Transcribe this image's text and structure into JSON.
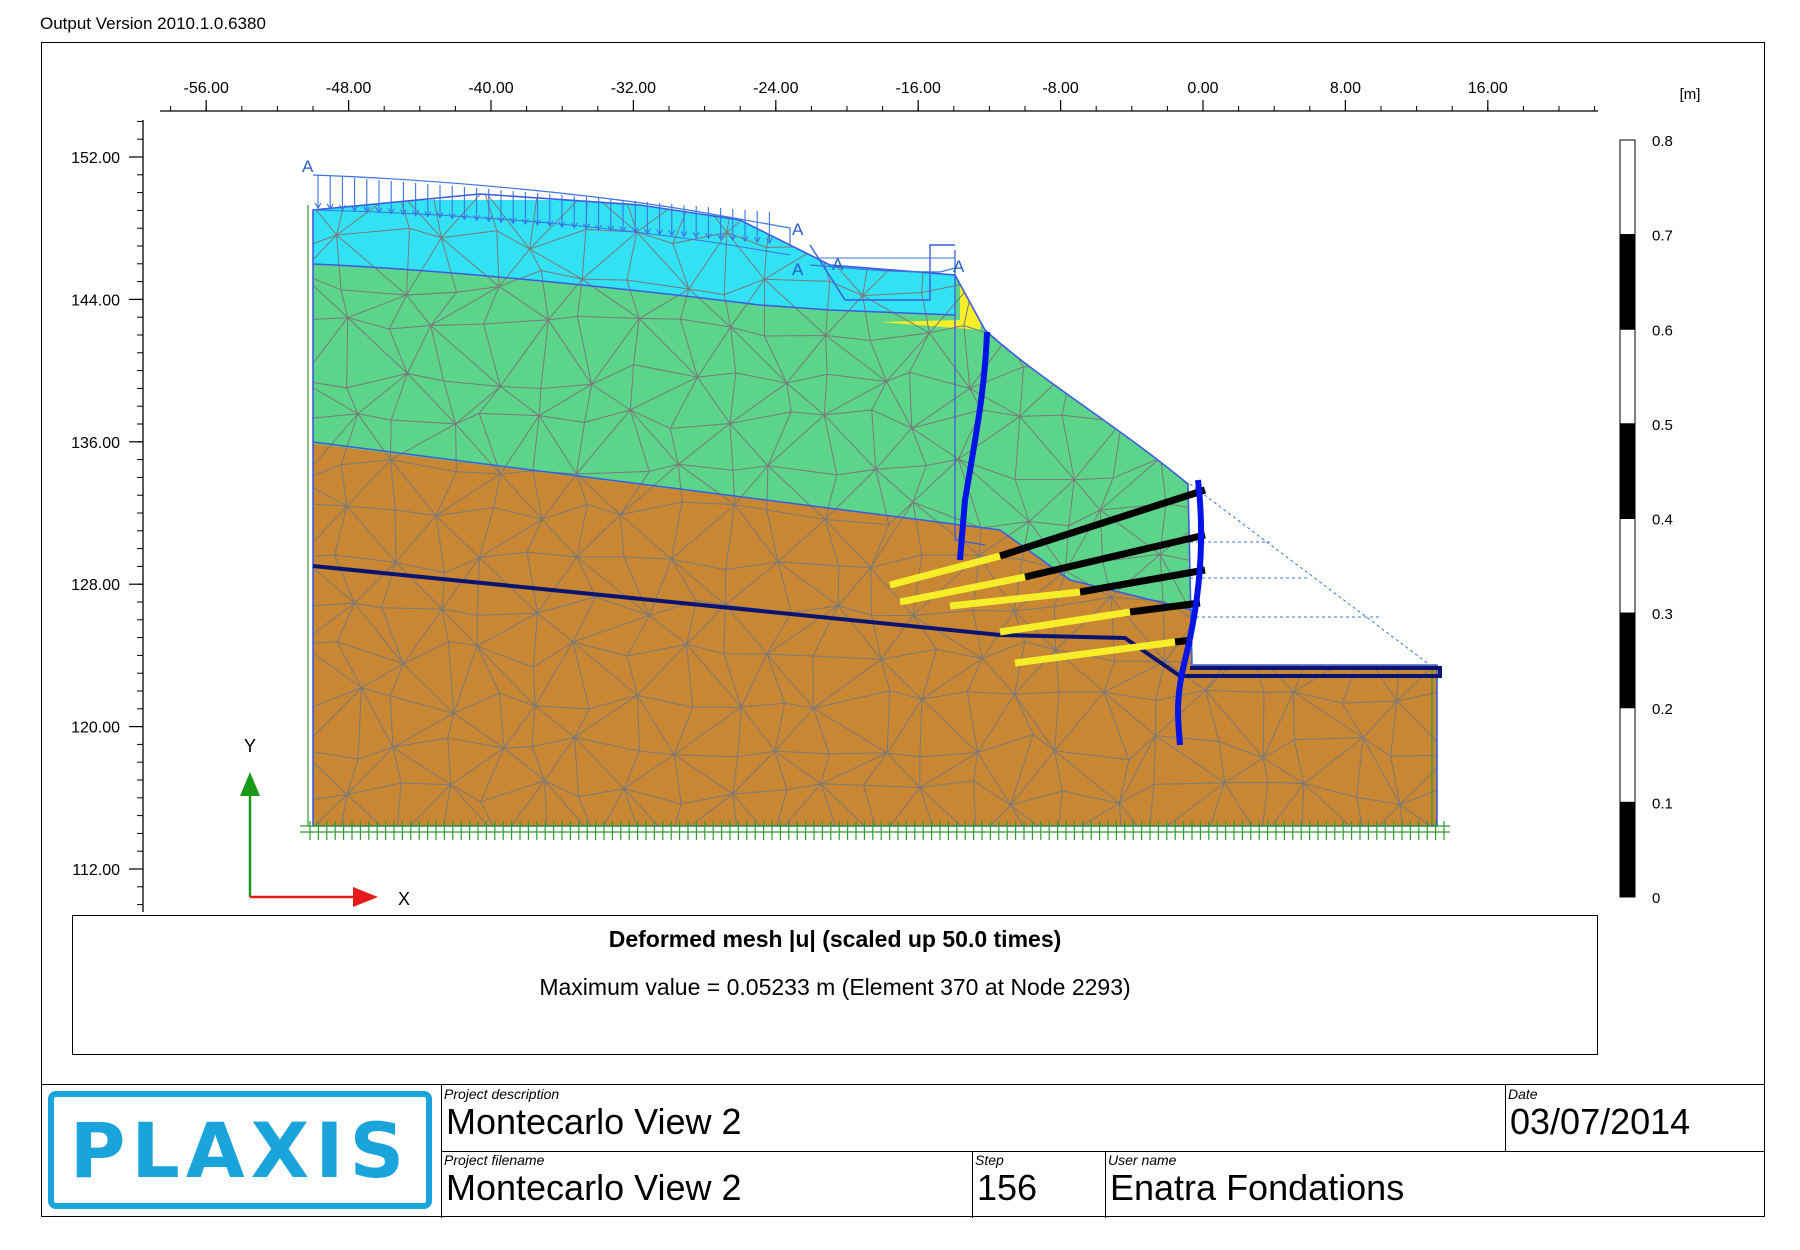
{
  "header": {
    "version": "Output Version 2010.1.0.6380"
  },
  "axes": {
    "x_ticks": [
      -56,
      -48,
      -40,
      -32,
      -24,
      -16,
      -8,
      0,
      8,
      16
    ],
    "x_tick_labels": [
      "-56.00",
      "-48.00",
      "-40.00",
      "-32.00",
      "-24.00",
      "-16.00",
      "-8.00",
      "0.00",
      "8.00",
      "16.00"
    ],
    "y_ticks": [
      152,
      144,
      136,
      128,
      120,
      112
    ],
    "y_tick_labels": [
      "152.00",
      "144.00",
      "136.00",
      "128.00",
      "120.00",
      "112.00"
    ],
    "unit": "[m]",
    "x_name": "X",
    "y_name": "Y"
  },
  "scale_bar": {
    "labels": [
      "0.8",
      "0.7",
      "0.6",
      "0.5",
      "0.4",
      "0.3",
      "0.2",
      "0.1",
      "0"
    ],
    "fill_black": "#000000",
    "fill_white": "#ffffff"
  },
  "model": {
    "colors": {
      "fill_layer": "#33e1f4",
      "silt_layer": "#5cd48a",
      "clay_layer": "#c98633",
      "yellow_block": "#f5ee29",
      "wall": "#0014e6",
      "anchor_free": "#000000",
      "anchor_grout": "#f5ee29",
      "load": "#3b74e0",
      "mesh": "#7a7a7a",
      "boundary": "#2f9a2f"
    },
    "load_markers": [
      "A",
      "A",
      "A",
      "A",
      "A"
    ]
  },
  "title": {
    "main": "Deformed mesh |u| (scaled up 50.0 times)",
    "sub": "Maximum value = 0.05233 m (Element 370 at Node 2293)"
  },
  "footer": {
    "logo": "PLAXIS",
    "project_description_label": "Project description",
    "project_description": "Montecarlo View 2",
    "date_label": "Date",
    "date": "03/07/2014",
    "project_filename_label": "Project filename",
    "project_filename": "Montecarlo View 2",
    "step_label": "Step",
    "step": "156",
    "user_label": "User name",
    "user": "Enatra Fondations"
  }
}
